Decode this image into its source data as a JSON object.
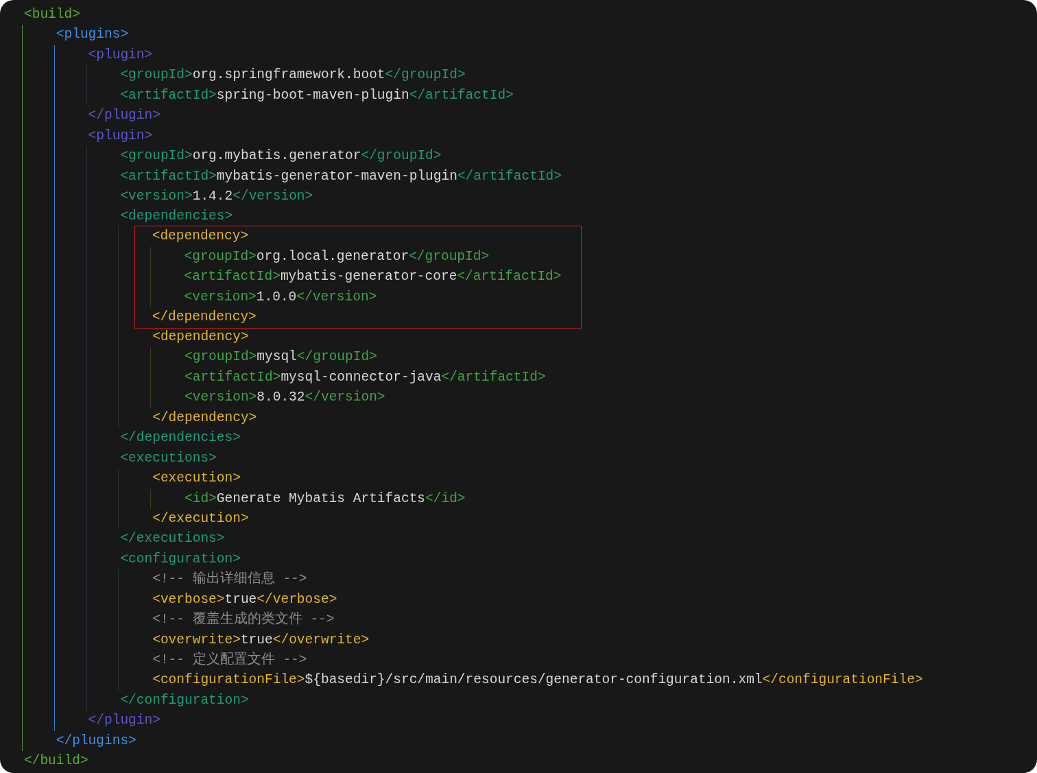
{
  "code": {
    "kind": "element",
    "open": "<build>",
    "close": "</build>",
    "children": [
      {
        "kind": "element",
        "open": "<plugins>",
        "close": "</plugins>",
        "children": [
          {
            "kind": "element",
            "open": "<plugin>",
            "close": "</plugin>",
            "children": [
              {
                "kind": "leaf",
                "open": "<groupId>",
                "value": "org.springframework.boot",
                "close": "</groupId>"
              },
              {
                "kind": "leaf",
                "open": "<artifactId>",
                "value": "spring-boot-maven-plugin",
                "close": "</artifactId>"
              }
            ]
          },
          {
            "kind": "element",
            "open": "<plugin>",
            "close": "</plugin>",
            "children": [
              {
                "kind": "leaf",
                "open": "<groupId>",
                "value": "org.mybatis.generator",
                "close": "</groupId>"
              },
              {
                "kind": "leaf",
                "open": "<artifactId>",
                "value": "mybatis-generator-maven-plugin",
                "close": "</artifactId>"
              },
              {
                "kind": "leaf",
                "open": "<version>",
                "value": "1.4.2",
                "close": "</version>"
              },
              {
                "kind": "element",
                "open": "<dependencies>",
                "close": "</dependencies>",
                "children": [
                  {
                    "kind": "element",
                    "open": "<dependency>",
                    "close": "</dependency>",
                    "highlighted": true,
                    "children": [
                      {
                        "kind": "leaf",
                        "open": "<groupId>",
                        "value": "org.local.generator",
                        "close": "</groupId>"
                      },
                      {
                        "kind": "leaf",
                        "open": "<artifactId>",
                        "value": "mybatis-generator-core",
                        "close": "</artifactId>"
                      },
                      {
                        "kind": "leaf",
                        "open": "<version>",
                        "value": "1.0.0",
                        "close": "</version>"
                      }
                    ]
                  },
                  {
                    "kind": "element",
                    "open": "<dependency>",
                    "close": "</dependency>",
                    "children": [
                      {
                        "kind": "leaf",
                        "open": "<groupId>",
                        "value": "mysql",
                        "close": "</groupId>"
                      },
                      {
                        "kind": "leaf",
                        "open": "<artifactId>",
                        "value": "mysql-connector-java",
                        "close": "</artifactId>"
                      },
                      {
                        "kind": "leaf",
                        "open": "<version>",
                        "value": "8.0.32",
                        "close": "</version>"
                      }
                    ]
                  }
                ]
              },
              {
                "kind": "element",
                "open": "<executions>",
                "close": "</executions>",
                "children": [
                  {
                    "kind": "element",
                    "open": "<execution>",
                    "close": "</execution>",
                    "children": [
                      {
                        "kind": "leaf",
                        "open": "<id>",
                        "value": "Generate Mybatis Artifacts",
                        "close": "</id>"
                      }
                    ]
                  }
                ]
              },
              {
                "kind": "element",
                "open": "<configuration>",
                "close": "</configuration>",
                "children": [
                  {
                    "kind": "comment",
                    "text": "<!-- 输出详细信息 -->"
                  },
                  {
                    "kind": "leaf",
                    "open": "<verbose>",
                    "value": "true",
                    "close": "</verbose>"
                  },
                  {
                    "kind": "comment",
                    "text": "<!-- 覆盖生成的类文件 -->"
                  },
                  {
                    "kind": "leaf",
                    "open": "<overwrite>",
                    "value": "true",
                    "close": "</overwrite>"
                  },
                  {
                    "kind": "comment",
                    "text": "<!-- 定义配置文件 -->"
                  },
                  {
                    "kind": "leaf",
                    "open": "<configurationFile>",
                    "value": "${basedir}/src/main/resources/generator-configuration.xml",
                    "close": "</configurationFile>"
                  }
                ]
              }
            ]
          }
        ]
      }
    ]
  }
}
